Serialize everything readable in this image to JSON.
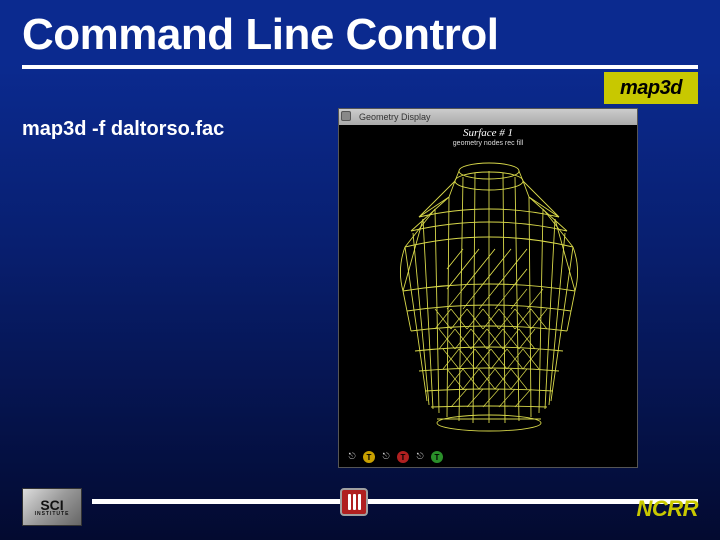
{
  "slide": {
    "title": "Command Line Control",
    "badge": "map3d",
    "command": "map3d -f daltorso.fac",
    "footer_org": "NCRR",
    "sci_top": "SCI",
    "sci_bottom": "INSTITUTE"
  },
  "viewer": {
    "window_title": "Geometry Display",
    "surface_label": "Surface # 1",
    "sublabel": "geometry nodes rec fill",
    "indicators": [
      "T",
      "T",
      "T"
    ],
    "indicator_colors": [
      "#c8a000",
      "#b02020",
      "#2a8f2a"
    ]
  }
}
